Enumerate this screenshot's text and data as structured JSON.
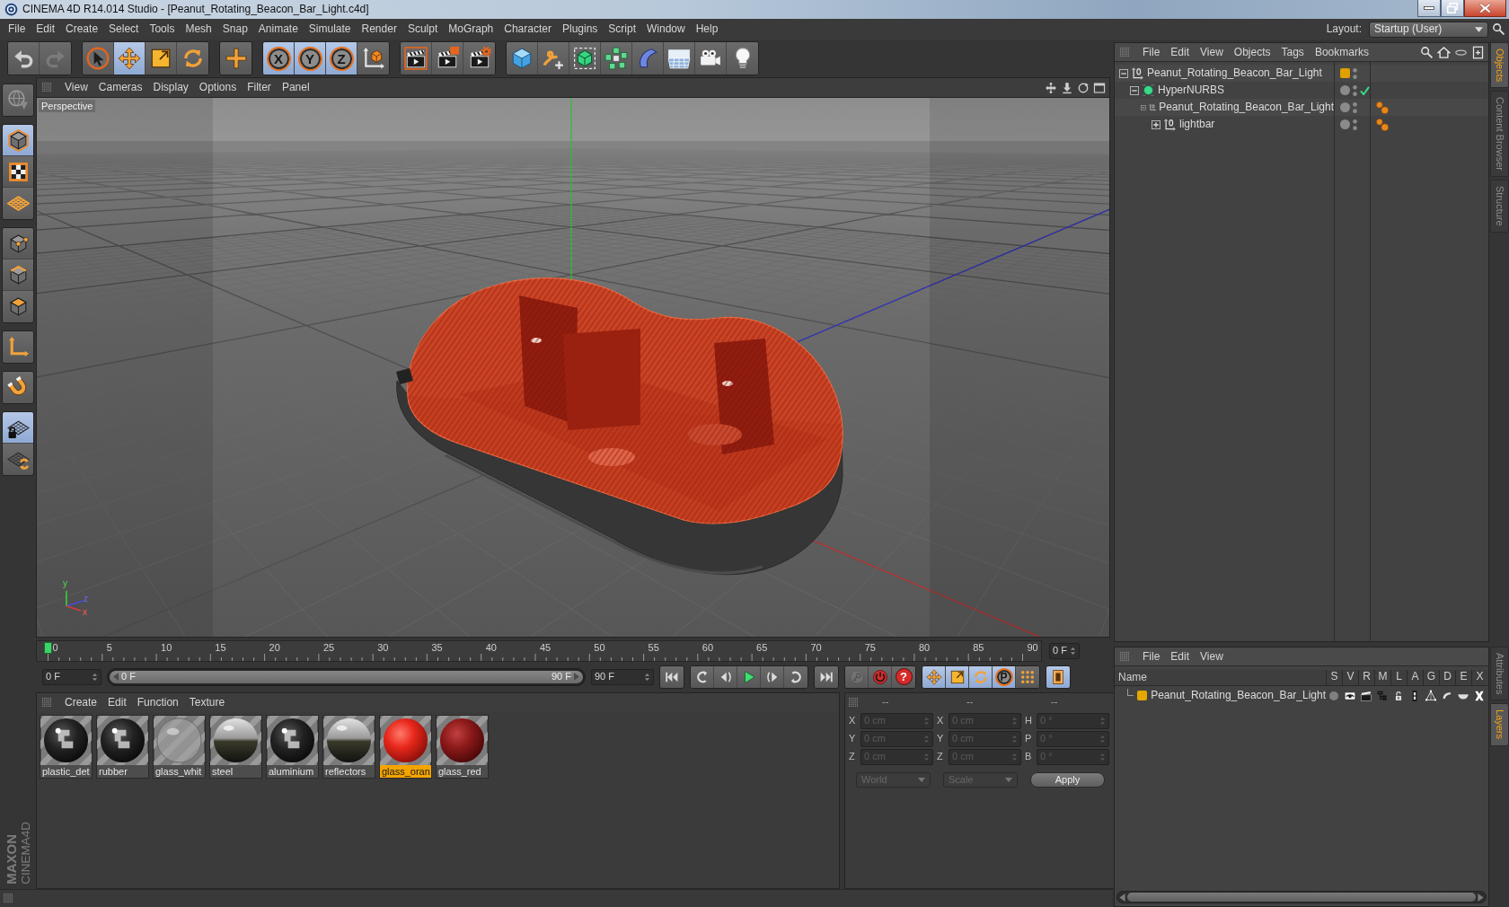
{
  "window": {
    "title": "CINEMA 4D R14.014 Studio - [Peanut_Rotating_Beacon_Bar_Light.c4d]"
  },
  "menu": [
    "File",
    "Edit",
    "Create",
    "Select",
    "Tools",
    "Mesh",
    "Snap",
    "Animate",
    "Simulate",
    "Render",
    "Sculpt",
    "MoGraph",
    "Character",
    "Plugins",
    "Script",
    "Window",
    "Help"
  ],
  "layout": {
    "label": "Layout:",
    "value": "Startup (User)"
  },
  "toolbar": [
    [
      {
        "kind": "undo",
        "selected": false,
        "disabled": false
      },
      {
        "kind": "redo",
        "selected": false,
        "disabled": true
      }
    ],
    [
      {
        "kind": "select",
        "selected": false,
        "disabled": false
      },
      {
        "kind": "move",
        "selected": true,
        "disabled": false
      },
      {
        "kind": "scale",
        "selected": false,
        "disabled": false
      },
      {
        "kind": "rotate",
        "selected": false,
        "disabled": false
      }
    ],
    [
      {
        "kind": "add",
        "selected": false,
        "disabled": false
      }
    ],
    [
      {
        "kind": "axis",
        "label": "X",
        "selected": true,
        "disabled": false
      },
      {
        "kind": "axis",
        "label": "Y",
        "selected": true,
        "disabled": false
      },
      {
        "kind": "axis",
        "label": "Z",
        "selected": true,
        "disabled": false
      },
      {
        "kind": "coords",
        "selected": false,
        "disabled": false
      }
    ],
    [
      {
        "kind": "render_view",
        "selected": false,
        "disabled": false
      },
      {
        "kind": "render_picture",
        "selected": false,
        "disabled": false
      },
      {
        "kind": "render_settings",
        "selected": false,
        "disabled": false
      }
    ],
    [
      {
        "kind": "cube",
        "selected": false,
        "disabled": false
      },
      {
        "kind": "pen",
        "selected": false,
        "disabled": false
      },
      {
        "kind": "subdivision",
        "selected": false,
        "disabled": false
      },
      {
        "kind": "cloner",
        "selected": false,
        "disabled": false
      },
      {
        "kind": "deformer",
        "selected": false,
        "disabled": false
      },
      {
        "kind": "floor",
        "selected": false,
        "disabled": false
      },
      {
        "kind": "camera",
        "selected": false,
        "disabled": false
      },
      {
        "kind": "light",
        "selected": false,
        "disabled": false
      }
    ]
  ],
  "tools_left": [
    [
      {
        "kind": "editable",
        "selected": false
      }
    ],
    [
      {
        "kind": "model",
        "selected": true
      },
      {
        "kind": "texture",
        "selected": false
      },
      {
        "kind": "workplane",
        "selected": false
      }
    ],
    [
      {
        "kind": "points",
        "selected": false
      },
      {
        "kind": "edges",
        "selected": false
      },
      {
        "kind": "polygons",
        "selected": false
      }
    ],
    [
      {
        "kind": "axis",
        "selected": false
      }
    ],
    [
      {
        "kind": "tweak",
        "selected": false
      }
    ],
    [
      {
        "kind": "lock",
        "selected": true
      },
      {
        "kind": "snap",
        "selected": false
      }
    ]
  ],
  "viewport": {
    "menu": [
      "View",
      "Cameras",
      "Display",
      "Options",
      "Filter",
      "Panel"
    ],
    "camera": "Perspective",
    "axis_labels": [
      "y",
      "z",
      "x"
    ]
  },
  "timeline": {
    "ticks": [
      "0",
      "5",
      "10",
      "15",
      "20",
      "25",
      "30",
      "35",
      "40",
      "45",
      "50",
      "55",
      "60",
      "65",
      "70",
      "75",
      "80",
      "85",
      "90"
    ],
    "level": 0,
    "frame": "0 F"
  },
  "transport": {
    "start": "0 F",
    "range_start": "0 F",
    "range_end": "90 F",
    "level": 1,
    "end": "90 F",
    "buttons": [
      [
        {
          "kind": "first",
          "selected": false,
          "disabled": false
        }
      ],
      [
        {
          "kind": "prev_key",
          "selected": false,
          "disabled": false
        },
        {
          "kind": "prev_frame",
          "selected": false,
          "disabled": false
        },
        {
          "kind": "play",
          "selected": false,
          "disabled": false
        },
        {
          "kind": "next_frame",
          "selected": false,
          "disabled": false
        },
        {
          "kind": "next_key",
          "selected": false,
          "disabled": false
        }
      ],
      [
        {
          "kind": "last",
          "selected": false,
          "disabled": false
        }
      ],
      [
        {
          "kind": "key_selection",
          "selected": false,
          "disabled": true
        },
        {
          "kind": "record",
          "selected": false,
          "disabled": false
        },
        {
          "kind": "keyset",
          "label": "?",
          "selected": false,
          "disabled": false
        }
      ],
      [
        {
          "kind": "pos",
          "selected": true,
          "disabled": false
        },
        {
          "kind": "scl",
          "selected": true,
          "disabled": false
        },
        {
          "kind": "rot",
          "selected": true,
          "disabled": false
        },
        {
          "kind": "param",
          "label": "P",
          "selected": true,
          "disabled": false
        },
        {
          "kind": "pla",
          "selected": false,
          "disabled": false
        }
      ],
      [
        {
          "kind": "timeline",
          "selected": true,
          "disabled": false
        }
      ]
    ]
  },
  "materials": {
    "menu": [
      "Create",
      "Edit",
      "Function",
      "Texture"
    ],
    "items": [
      {
        "name": "plastic_det",
        "kind": "textured",
        "selected": false
      },
      {
        "name": "rubber",
        "kind": "textured",
        "selected": false
      },
      {
        "name": "glass_whit",
        "kind": "clear",
        "selected": false
      },
      {
        "name": "steel",
        "kind": "chrome",
        "selected": false
      },
      {
        "name": "aluminium",
        "kind": "textured",
        "selected": false
      },
      {
        "name": "reflectors",
        "kind": "chrome",
        "selected": false
      },
      {
        "name": "glass_oran",
        "kind": "red",
        "selected": true
      },
      {
        "name": "glass_red",
        "kind": "maroon",
        "selected": false
      }
    ]
  },
  "coordinates": {
    "headers": [
      "--",
      "--",
      "--"
    ],
    "disabled": true,
    "rows": [
      [
        {
          "axis": "X",
          "value": "0 cm"
        },
        {
          "axis": "X",
          "value": "0 cm"
        },
        {
          "axis": "H",
          "value": "0 °"
        }
      ],
      [
        {
          "axis": "Y",
          "value": "0 cm"
        },
        {
          "axis": "Y",
          "value": "0 cm"
        },
        {
          "axis": "P",
          "value": "0 °"
        }
      ],
      [
        {
          "axis": "Z",
          "value": "0 cm"
        },
        {
          "axis": "Z",
          "value": "0 cm"
        },
        {
          "axis": "B",
          "value": "0 °"
        }
      ]
    ],
    "space": "World",
    "mode": "Scale",
    "apply": "Apply"
  },
  "objects": {
    "menu": [
      "File",
      "Edit",
      "View",
      "Objects",
      "Tags",
      "Bookmarks"
    ],
    "tree": [
      {
        "name": "Peanut_Rotating_Beacon_Bar_Light",
        "kind": "null",
        "expanded": true,
        "layer": true,
        "enabled": false,
        "tag": false,
        "children": [
          {
            "name": "HyperNURBS",
            "kind": "subdivision",
            "expanded": true,
            "layer": false,
            "enabled": true,
            "tag": false,
            "children": [
              {
                "name": "Peanut_Rotating_Beacon_Bar_Light",
                "kind": "null",
                "expanded": true,
                "layer": false,
                "enabled": false,
                "tag": true,
                "children": [
                  {
                    "name": "lightbar",
                    "kind": "null",
                    "expanded": false,
                    "layer": false,
                    "enabled": false,
                    "tag": true
                  }
                ]
              }
            ]
          }
        ]
      }
    ]
  },
  "layers": {
    "menu": [
      "File",
      "Edit",
      "View"
    ],
    "columns": [
      "Name",
      "S",
      "V",
      "R",
      "M",
      "L",
      "A",
      "G",
      "D",
      "E",
      "X"
    ],
    "rows": [
      {
        "name": "Peanut_Rotating_Beacon_Bar_Light",
        "color": "#e5a600",
        "solo": false
      }
    ]
  },
  "side_tabs": {
    "top": [
      {
        "label": "Objects",
        "selected": true
      },
      {
        "label": "Content Browser",
        "selected": false
      },
      {
        "label": "Structure",
        "selected": false
      }
    ],
    "bottom": [
      {
        "label": "Attributes",
        "selected": false
      },
      {
        "label": "Layers",
        "selected": true
      }
    ]
  },
  "logo": {
    "brand": "MAXON",
    "product": "CINEMA4D"
  }
}
